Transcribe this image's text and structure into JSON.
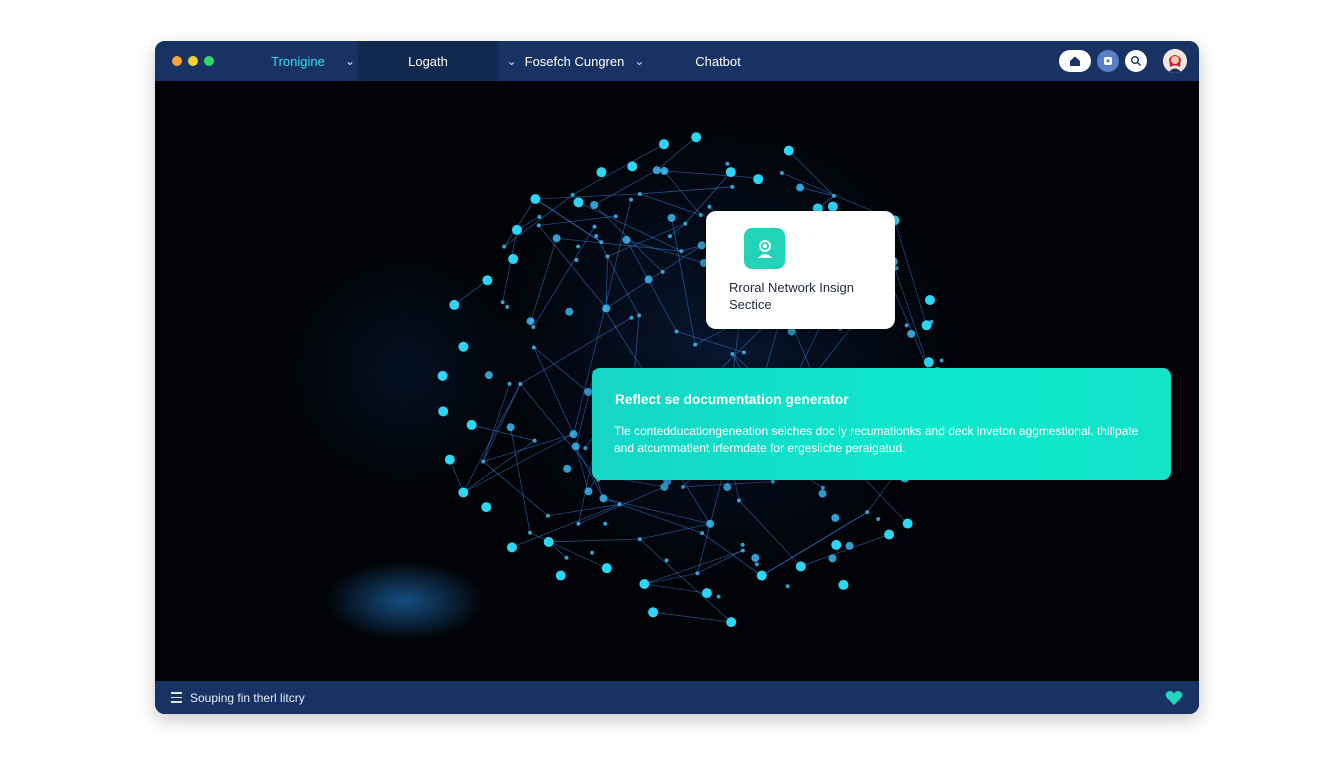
{
  "window": {
    "tabs": [
      {
        "label": "Tronigine",
        "has_chevron": true,
        "active": false
      },
      {
        "label": "Logath",
        "has_chevron": false,
        "active": true
      },
      {
        "label": "Fosefch Cungren",
        "has_chevron": true,
        "active": false
      },
      {
        "label": "Chatbot",
        "has_chevron": false,
        "active": false
      }
    ],
    "controls": [
      "close-dot",
      "minimize-dot",
      "maximize-dot"
    ],
    "toolbar_icons": [
      "home-icon",
      "notification-icon",
      "search-icon",
      "user-avatar-icon"
    ]
  },
  "card": {
    "icon": "support-agent-icon",
    "title": "Rroral Network Insign Sectice"
  },
  "banner": {
    "title": "Reflect se documentation generator",
    "body": "Tle contedducationgeneation seiches doc ly recumationks and deck inveton aggmestional. thillpate and atcummatient irfermdate for ergesiiche peraigatud."
  },
  "statusbar": {
    "text": "Souping fin therl litcry",
    "heart_icon": "heart-icon"
  },
  "colors": {
    "titlebar": "#173263",
    "accent": "#0ee8cc",
    "node": "#22c8f0",
    "background": "#010307"
  }
}
